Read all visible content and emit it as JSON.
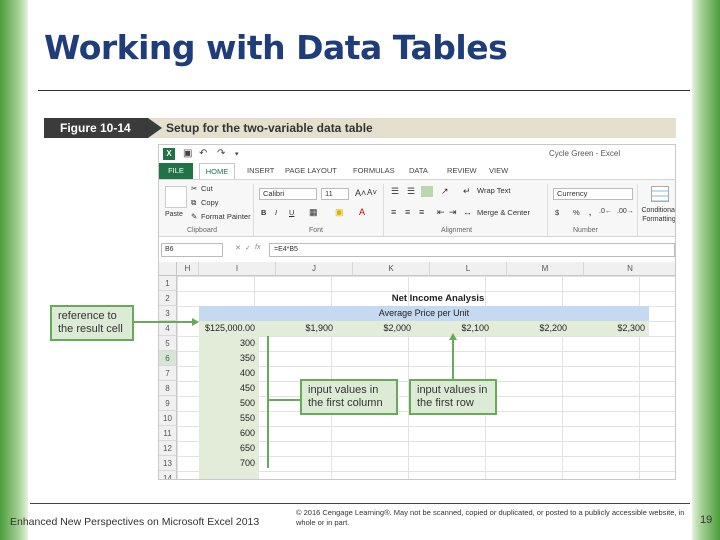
{
  "slide": {
    "title": "Working with Data Tables",
    "figure_label": "Figure 10-14",
    "figure_caption": "Setup for the two-variable data table",
    "footer_left": "Enhanced New Perspectives on Microsoft Excel 2013",
    "footer_copyright": "© 2016 Cengage Learning®. May not be scanned, copied or duplicated, or posted to a publicly accessible website, in whole or in part.",
    "page_number": "19"
  },
  "excel": {
    "app_icon": "X",
    "window_title": "Cycle Green - Excel",
    "tabs": {
      "file": "FILE",
      "home": "HOME",
      "insert": "INSERT",
      "page_layout": "PAGE LAYOUT",
      "formulas": "FORMULAS",
      "data": "DATA",
      "review": "REVIEW",
      "view": "VIEW"
    },
    "ribbon": {
      "cut": "Cut",
      "copy": "Copy",
      "format_painter": "Format Painter",
      "paste": "Paste",
      "font_name": "Calibri",
      "font_size": "11",
      "wrap_text": "Wrap Text",
      "merge_center": "Merge & Center",
      "number_format": "Currency",
      "percent": "%",
      "comma": ",",
      "dollar": "$",
      "conditional_formatting": "Conditional Formatting",
      "group_clipboard": "Clipboard",
      "group_font": "Font",
      "group_alignment": "Alignment",
      "group_number": "Number",
      "bold": "B",
      "italic": "I",
      "underline": "U"
    },
    "formula_bar": {
      "name_box": "B6",
      "formula": "=E4*B5"
    },
    "columns": [
      "H",
      "I",
      "J",
      "K",
      "L",
      "M",
      "N"
    ],
    "rows": [
      "1",
      "2",
      "3",
      "4",
      "5",
      "6",
      "7",
      "8",
      "9",
      "10",
      "11",
      "12",
      "13",
      "14"
    ],
    "selected_row": "6",
    "sheet_title": "Net Income Analysis",
    "sheet_subtitle": "Average Price per Unit",
    "result_cell": "$125,000.00",
    "row_inputs": [
      "$1,900",
      "$2,000",
      "$2,100",
      "$2,200",
      "$2,300"
    ],
    "column_inputs": [
      "300",
      "350",
      "400",
      "450",
      "500",
      "550",
      "600",
      "650",
      "700"
    ]
  },
  "callouts": {
    "result_cell": "reference to the result cell",
    "column_inputs": "input values in the first column",
    "row_inputs": "input values in the first row"
  },
  "colors": {
    "excel_green": "#217346",
    "callout_fill": "#dcebd6",
    "callout_border": "#68a95a",
    "band_blue": "#c5d9f1",
    "title_blue": "#1f3d7a"
  }
}
